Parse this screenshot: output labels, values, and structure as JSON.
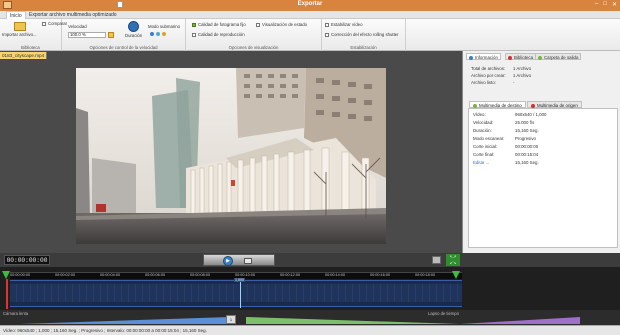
{
  "window": {
    "title": "Exportar"
  },
  "tabs": {
    "inicio": "Inicio",
    "export": "Exportar archivo multimedia optimizado"
  },
  "ribbon": {
    "import_label": "Importar archivo...",
    "group_biblioteca": "Biblioteca",
    "group_velocidad": "Opciones de control de la velocidad",
    "group_visualizacion": "Opciones de visualización",
    "group_estabilizacion": "Estabilización",
    "comparar": "Comparar",
    "velocidad_label": "Velocidad",
    "velocidad_value": "100.0 %",
    "duracion": "Duración",
    "modo_submarino": "Modo submarino",
    "calidad_fotograma": "Calidad de fotograma fijo",
    "visualizacion_estado": "Visualización de estado",
    "calidad_reproduccion": "Calidad de reproducción",
    "estabilizar_video": "Estabilizar vídeo",
    "correccion_rolling": "Corrección del efecto rolling shutter"
  },
  "document": {
    "tab_label": "0183_cityscape.mp4"
  },
  "right": {
    "tabs": [
      "Información",
      "Biblioteca",
      "Carpeta de salida"
    ],
    "summary": [
      {
        "k": "Total de archivos:",
        "v": "1 Archivo"
      },
      {
        "k": "Archivo por crear:",
        "v": "1 Archivo"
      },
      {
        "k": "Archivo listo:",
        "v": "-"
      }
    ],
    "subtabs": [
      "Multimedia de destino",
      "Multimedia de origen"
    ],
    "details": [
      {
        "k": "Vídeo:",
        "v": "960x540 / 1,000"
      },
      {
        "k": "Velocidad:",
        "v": "25.000 f/s"
      },
      {
        "k": "Duración:",
        "v": "15,160 Seg."
      },
      {
        "k": "Modo escanear:",
        "v": "Progresivo"
      },
      {
        "k": "Corte inicial:",
        "v": "00:00:00:00"
      },
      {
        "k": "Corte final:",
        "v": "00:00:15:04"
      },
      {
        "k": "Editar ...",
        "v": "15,160 Seg."
      }
    ]
  },
  "player": {
    "timecode": "00:00:00:00",
    "play_icon": "play-icon",
    "camera_icon": "camera-icon"
  },
  "timeline": {
    "ticks": [
      "00:00:00:00",
      "00:00:02:00",
      "00:00:04:00",
      "00:00:06:00",
      "00:00:08:00",
      "00:00:10:00",
      "00:00:12:00",
      "00:00:14:00",
      "00:00:16:00",
      "00:00:18:00",
      "00:00:20:00"
    ],
    "cursor_label": "1,000"
  },
  "zoom": {
    "left": "Cámara lenta",
    "right": "Lapso de tiempo",
    "thumb": "1"
  },
  "status": "Vídeo: 960x540 ; 1,000 ; 15,160 Seg. ; Progresivo ; Intervalo: 00:00:00:00 a 00:00:15:04 ; 15,160 Seg.",
  "colors": {
    "accent": "#d8833e",
    "timeline_blue": "#3a5ea8",
    "green": "#3cbd3c"
  }
}
